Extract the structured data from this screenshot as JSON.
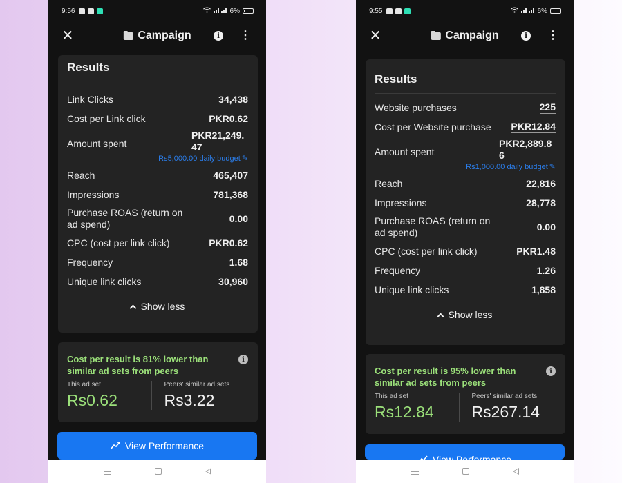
{
  "left": {
    "status": {
      "time": "9:56",
      "battery": "6%"
    },
    "header": {
      "title": "Campaign"
    },
    "results": {
      "title": "Results",
      "metrics": [
        {
          "label": "Link Clicks",
          "value": "34,438"
        },
        {
          "label": "Cost per Link click",
          "value": "PKR0.62"
        },
        {
          "label": "Amount spent",
          "value": "PKR21,249.\n47"
        },
        {
          "label": "Reach",
          "value": "465,407"
        },
        {
          "label": "Impressions",
          "value": "781,368"
        },
        {
          "label": "Purchase ROAS (return on ad spend)",
          "value": "0.00"
        },
        {
          "label": "CPC (cost per link click)",
          "value": "PKR0.62"
        },
        {
          "label": "Frequency",
          "value": "1.68"
        },
        {
          "label": "Unique link clicks",
          "value": "30,960"
        }
      ],
      "budget": "Rs5,000.00 daily budget",
      "show_less": "Show less"
    },
    "compare": {
      "text": "Cost per result is 81% lower than similar ad sets from peers",
      "this_label": "This ad set",
      "this_value": "Rs0.62",
      "peers_label": "Peers' similar ad sets",
      "peers_value": "Rs3.22"
    },
    "view_button": "View Performance"
  },
  "right": {
    "status": {
      "time": "9:55",
      "battery": "6%"
    },
    "header": {
      "title": "Campaign"
    },
    "results": {
      "title": "Results",
      "metrics": [
        {
          "label": "Website purchases",
          "value": "225"
        },
        {
          "label": "Cost per Website purchase",
          "value": "PKR12.84"
        },
        {
          "label": "Amount spent",
          "value": "PKR2,889.8\n6"
        },
        {
          "label": "Reach",
          "value": "22,816"
        },
        {
          "label": "Impressions",
          "value": "28,778"
        },
        {
          "label": "Purchase ROAS (return on ad spend)",
          "value": "0.00"
        },
        {
          "label": "CPC (cost per link click)",
          "value": "PKR1.48"
        },
        {
          "label": "Frequency",
          "value": "1.26"
        },
        {
          "label": "Unique link clicks",
          "value": "1,858"
        }
      ],
      "budget": "Rs1,000.00 daily budget",
      "show_less": "Show less"
    },
    "compare": {
      "text": "Cost per result is 95% lower than similar ad sets from peers",
      "this_label": "This ad set",
      "this_value": "Rs12.84",
      "peers_label": "Peers' similar ad sets",
      "peers_value": "Rs267.14"
    },
    "view_button": "View Performance"
  }
}
